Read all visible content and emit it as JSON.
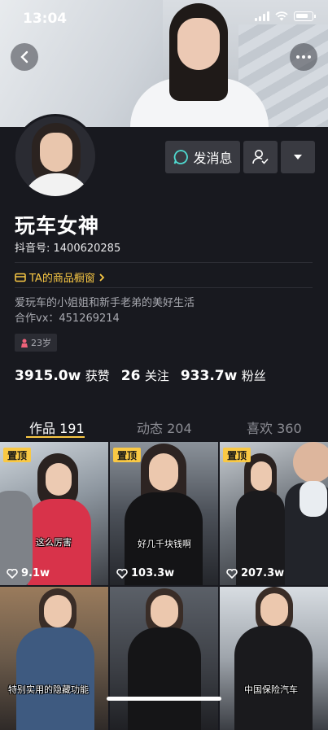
{
  "status_bar": {
    "time": "13:04"
  },
  "profile": {
    "name": "玩车女神",
    "douyin_id": "抖音号: 1400620285",
    "shop_label": "TA的商品橱窗",
    "bio_line1": "爱玩车的小姐姐和新手老弟的美好生活",
    "bio_line2": "合作vx：451269214",
    "age_tag": "23岁"
  },
  "actions": {
    "message_label": "发消息"
  },
  "stats": {
    "likes_value": "3915.0w",
    "likes_label": "获赞",
    "following_value": "26",
    "following_label": "关注",
    "followers_value": "933.7w",
    "followers_label": "粉丝"
  },
  "tabs": [
    {
      "label": "作品 191"
    },
    {
      "label": "动态 204"
    },
    {
      "label": "喜欢 360"
    }
  ],
  "videos": [
    {
      "pinned": "置顶",
      "caption": "这么厉害",
      "likes": "9.1w"
    },
    {
      "pinned": "置顶",
      "caption": "好几千块钱啊",
      "likes": "103.3w"
    },
    {
      "pinned": "置顶",
      "caption": "",
      "likes": "207.3w"
    },
    {
      "caption": "特别实用的隐藏功能"
    },
    {
      "caption": ""
    },
    {
      "caption": "中国保险汽车"
    }
  ],
  "colors": {
    "accent": "#f9c844",
    "background": "#18191f",
    "button": "#393a41"
  },
  "icons": [
    "back-icon",
    "more-icon",
    "message-icon",
    "follow-icon",
    "dropdown-icon",
    "heart-icon",
    "female-icon"
  ]
}
